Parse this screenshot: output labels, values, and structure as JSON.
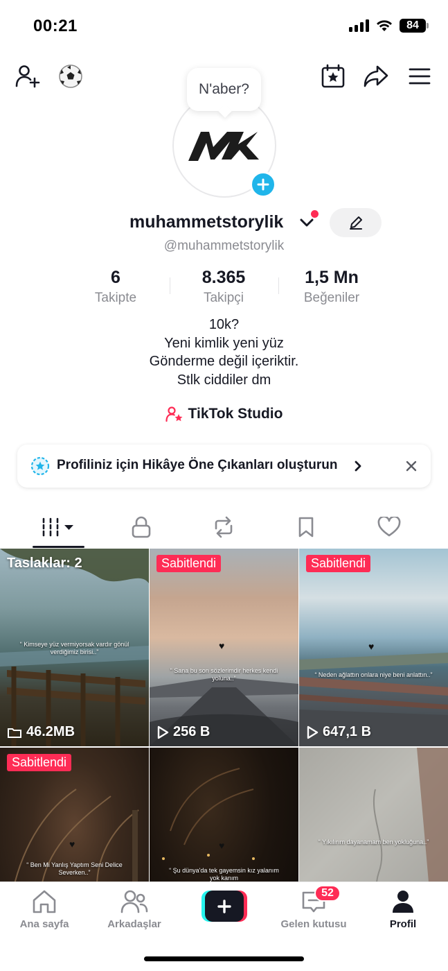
{
  "status_bar": {
    "time": "00:21",
    "battery": "84"
  },
  "header": {
    "bubble_text": "N'aber?"
  },
  "profile": {
    "username": "muhammetstorylik",
    "handle": "@muhammetstorylik",
    "avatar_text": "MK"
  },
  "stats": [
    {
      "value": "6",
      "label": "Takipte"
    },
    {
      "value": "8.365",
      "label": "Takipçi"
    },
    {
      "value": "1,5 Mn",
      "label": "Beğeniler"
    }
  ],
  "bio": [
    "10k?",
    "Yeni kimlik yeni yüz",
    "Gönderme değil içeriktir.",
    "Stlk ciddiler dm"
  ],
  "studio_label": "TikTok Studio",
  "banner_text": "Profiliniz için Hikâye Öne Çıkanları oluşturun",
  "tiles": [
    {
      "top_label": "Taslaklar: 2",
      "caption": "“ Kimseye yüz vermiyorsak vardır gönül verdiğimiz birisi..”",
      "foot": "46.2MB"
    },
    {
      "top_label": "Sabitlendi",
      "caption": "“ Sana bu son sözlerimdir herkes kendi yoluna..”",
      "foot": "256 B"
    },
    {
      "top_label": "Sabitlendi",
      "caption": "“ Neden ağlattın onlara niye beni anlattın..”",
      "foot": "647,1 B"
    },
    {
      "top_label": "Sabitlendi",
      "caption": "“ Ben Mi Yanlış Yaptım Seni Delice Severken..”",
      "foot": ""
    },
    {
      "top_label": "",
      "caption": "“ Şu dünya'da tek gayemsin kız yalanım yok kanım",
      "foot": ""
    },
    {
      "top_label": "",
      "caption": "“ Yıkılırım dayanamam ben yokluğuna..”",
      "foot": ""
    }
  ],
  "nav": {
    "home": "Ana sayfa",
    "friends": "Arkadaşlar",
    "inbox": "Gelen kutusu",
    "inbox_badge": "52",
    "profile": "Profil"
  },
  "colors": {
    "accent": "#fe2c55",
    "cyan": "#25f4ee",
    "blue": "#20b5ea",
    "text": "#161823",
    "muted": "#8a8b91"
  }
}
